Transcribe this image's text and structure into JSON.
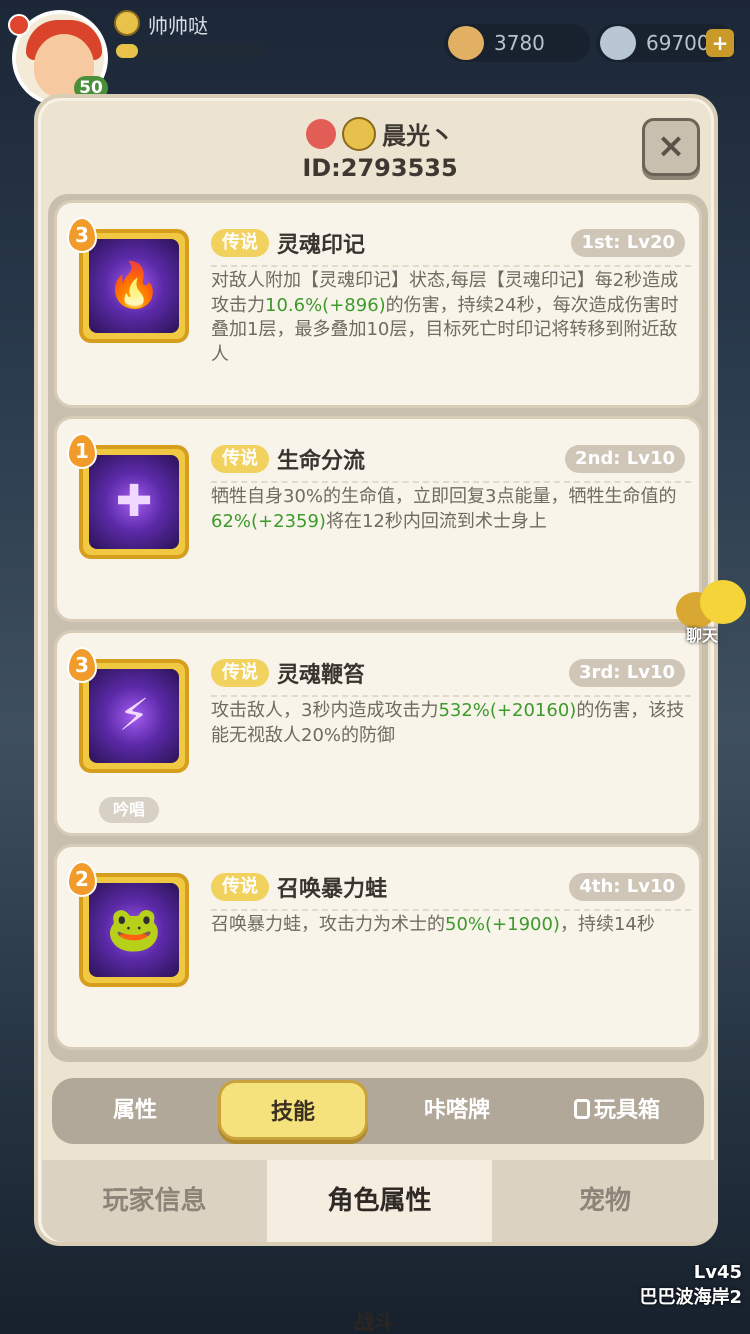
{
  "hud": {
    "player_name": "帅帅哒",
    "level": "50",
    "currency1": "3780",
    "currency2": "69700",
    "plus": "+"
  },
  "profile": {
    "name": "晨光丶",
    "id_text": "ID:2793535",
    "close_label": "×"
  },
  "skills": [
    {
      "badge": "3",
      "rarity": "传说",
      "name": "灵魂印记",
      "slot": "1st: Lv20",
      "glyph": "🔥",
      "desc_parts": [
        {
          "t": "对敌人附加【灵魂印记】状态,每层【灵魂印记】每2秒造成攻击力",
          "g": false
        },
        {
          "t": "10.6%(+896)",
          "g": true
        },
        {
          "t": "的伤害，持续24秒，每次造成伤害时叠加1层，最多叠加10层，目标死亡时印记将转移到附近敌人",
          "g": false
        }
      ]
    },
    {
      "badge": "1",
      "rarity": "传说",
      "name": "生命分流",
      "slot": "2nd: Lv10",
      "glyph": "✚",
      "desc_parts": [
        {
          "t": "牺牲自身30%的生命值，立即回复3点能量，牺牲生命值的",
          "g": false
        },
        {
          "t": "62%(+2359)",
          "g": true
        },
        {
          "t": "将在12秒内回流到术士身上",
          "g": false
        }
      ]
    },
    {
      "badge": "3",
      "rarity": "传说",
      "name": "灵魂鞭笞",
      "slot": "3rd: Lv10",
      "glyph": "⚡",
      "chant": "吟唱",
      "desc_parts": [
        {
          "t": "攻击敌人，3秒内造成攻击力",
          "g": false
        },
        {
          "t": "532%(+20160)",
          "g": true
        },
        {
          "t": "的伤害，该技能无视敌人20%的防御",
          "g": false
        }
      ]
    },
    {
      "badge": "2",
      "rarity": "传说",
      "name": "召唤暴力蛙",
      "slot": "4th: Lv10",
      "glyph": "🐸",
      "desc_parts": [
        {
          "t": "召唤暴力蛙，攻击力为术士的",
          "g": false
        },
        {
          "t": "50%(+1900)",
          "g": true
        },
        {
          "t": "，持续14秒",
          "g": false
        }
      ]
    }
  ],
  "sub_tabs": [
    "属性",
    "技能",
    "咔嗒牌",
    "玩具箱"
  ],
  "main_tabs": [
    "玩家信息",
    "角色属性",
    "宠物"
  ],
  "side": {
    "chat_label": "聊天",
    "zone_level": "Lv45",
    "zone_name": "巴巴波海岸2",
    "battle_label": "战斗"
  },
  "colors": {
    "highlight_green": "#3d9a2b",
    "rarity_gold": "#f2d25e",
    "active_tab": "#f6e27c"
  }
}
